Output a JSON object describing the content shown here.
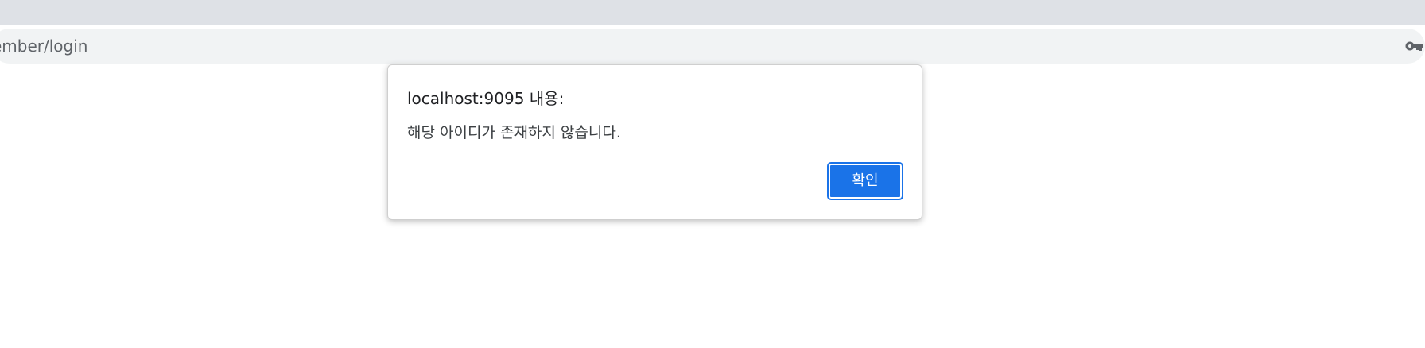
{
  "browser": {
    "url": "ember/login",
    "password_icon": "key-icon"
  },
  "dialog": {
    "title": "localhost:9095 내용:",
    "message": "해당 아이디가 존재하지 않습니다.",
    "ok_label": "확인"
  },
  "colors": {
    "tabstrip": "#dee1e6",
    "omnibox": "#f1f3f4",
    "button": "#1a73e8"
  }
}
